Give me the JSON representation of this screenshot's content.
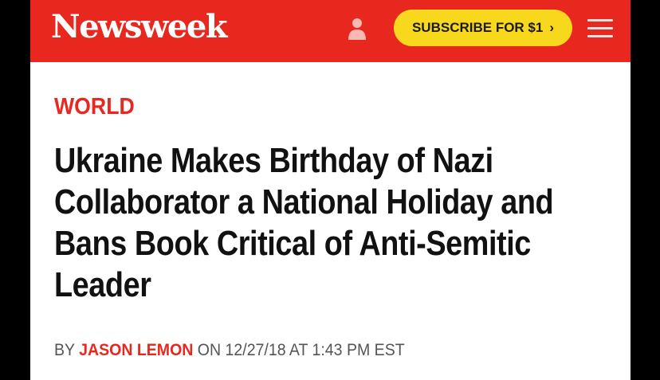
{
  "header": {
    "logo": "Newsweek",
    "subscribe_label": "SUBSCRIBE FOR $1",
    "subscribe_chevron": "›",
    "user_icon": "user-icon",
    "menu_icon": "hamburger-menu-icon"
  },
  "article": {
    "section": "WORLD",
    "headline": "Ukraine Makes Birthday of Nazi Collaborator a National Holiday and Bans Book Critical of Anti-Semitic Leader",
    "byline": {
      "by": "BY",
      "author": "JASON LEMON",
      "on": "ON",
      "date": "12/27/18",
      "at": "AT",
      "time": "1:43 PM EST"
    }
  },
  "colors": {
    "brand_red": "#e8281f",
    "subscribe_yellow": "#f8d81c",
    "headline_text": "#111111",
    "byline_text": "#555555"
  }
}
